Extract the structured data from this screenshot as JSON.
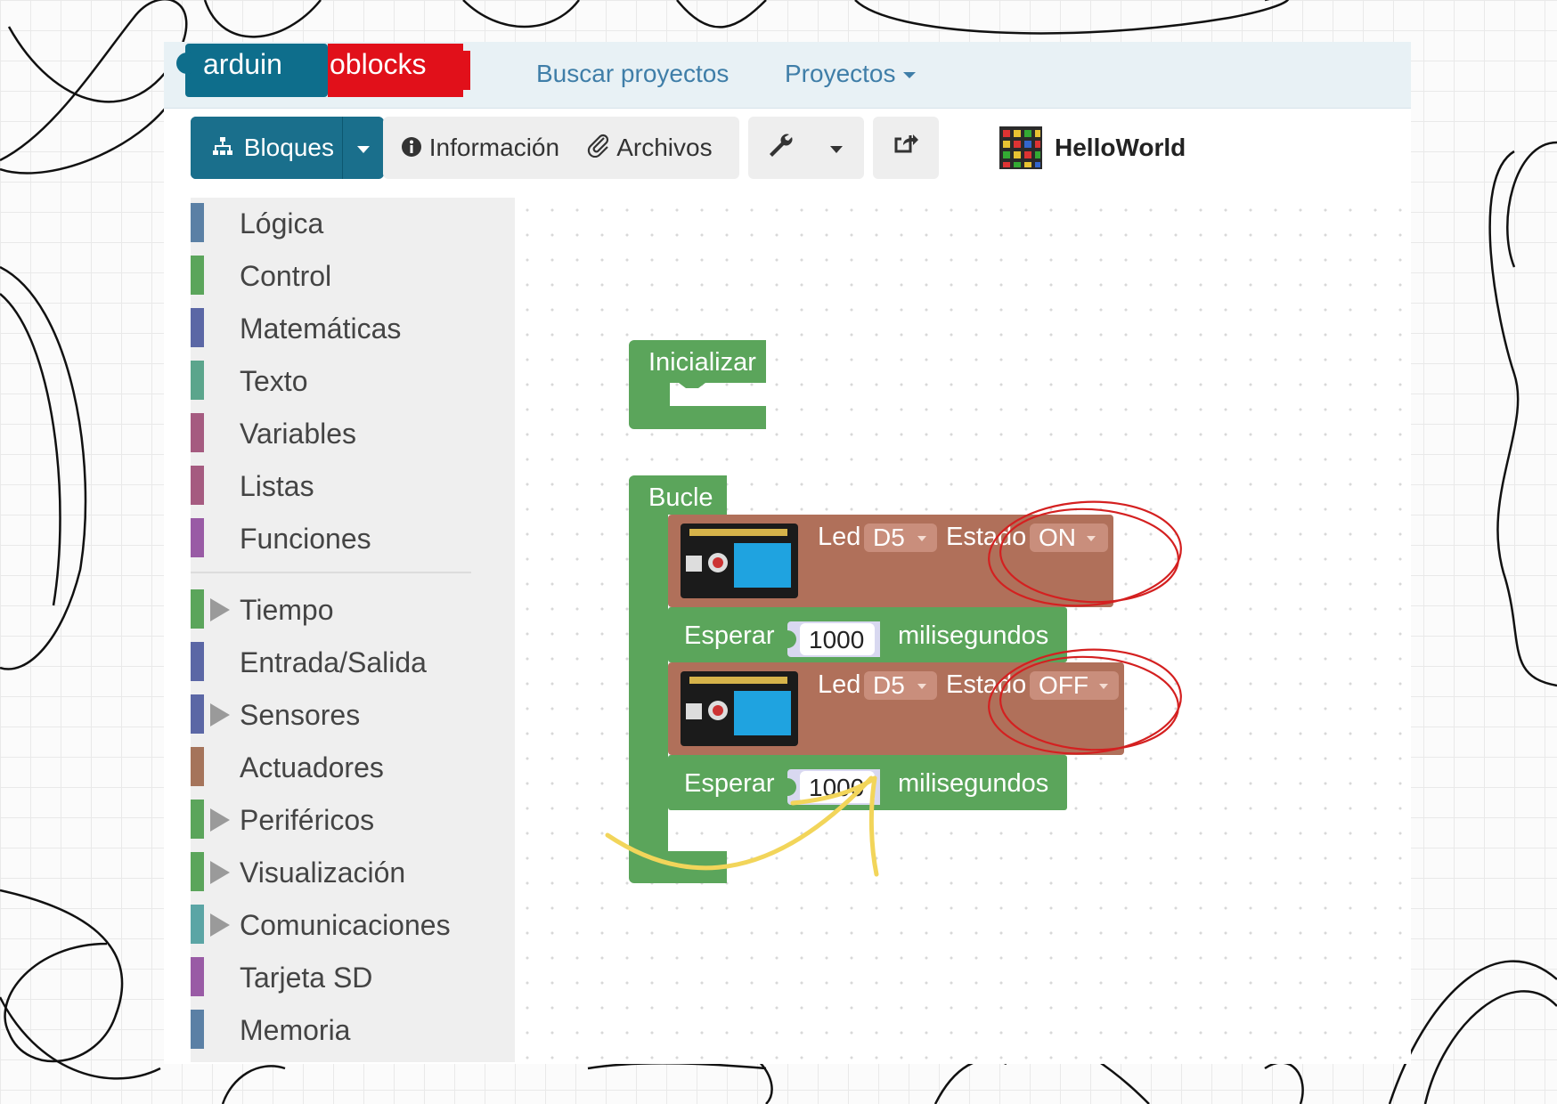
{
  "brand": {
    "logo_text_a": "arduin",
    "logo_text_b": "oblocks",
    "colors": {
      "teal": "#0e6e8c",
      "red": "#e1101a"
    }
  },
  "navbar": {
    "search_link": "Buscar proyectos",
    "projects_link": "Proyectos"
  },
  "toolbar": {
    "blocks_label": "Bloques",
    "info_label": "Información",
    "files_label": "Archivos",
    "project_name": "HelloWorld",
    "icons": {
      "blocks": "sitemap-icon",
      "info": "info-circle-icon",
      "files": "paperclip-icon",
      "tools": "wrench-icon",
      "share": "share-icon"
    }
  },
  "categories": [
    {
      "label": "Lógica",
      "color": "#5b80a5",
      "expandable": false
    },
    {
      "label": "Control",
      "color": "#5ba55b",
      "expandable": false
    },
    {
      "label": "Matemáticas",
      "color": "#5b67a5",
      "expandable": false
    },
    {
      "label": "Texto",
      "color": "#5ba58c",
      "expandable": false
    },
    {
      "label": "Variables",
      "color": "#a55b80",
      "expandable": false
    },
    {
      "label": "Listas",
      "color": "#a55b80",
      "expandable": false
    },
    {
      "label": "Funciones",
      "color": "#995ba5",
      "expandable": false
    },
    {
      "label": "Tiempo",
      "color": "#5ba55b",
      "expandable": true
    },
    {
      "label": "Entrada/Salida",
      "color": "#5b67a5",
      "expandable": false
    },
    {
      "label": "Sensores",
      "color": "#5b67a5",
      "expandable": true
    },
    {
      "label": "Actuadores",
      "color": "#a5745b",
      "expandable": false
    },
    {
      "label": "Periféricos",
      "color": "#5ba55b",
      "expandable": true
    },
    {
      "label": "Visualización",
      "color": "#5ba55b",
      "expandable": true
    },
    {
      "label": "Comunicaciones",
      "color": "#5ba5a5",
      "expandable": true
    },
    {
      "label": "Tarjeta SD",
      "color": "#995ba5",
      "expandable": false
    },
    {
      "label": "Memoria",
      "color": "#5b80a5",
      "expandable": false
    }
  ],
  "blocks": {
    "init_label": "Inicializar",
    "loop_label": "Bucle",
    "led1": {
      "led_label": "Led",
      "pin": "D5",
      "state_label": "Estado",
      "state": "ON"
    },
    "wait1": {
      "label": "Esperar",
      "value": "1000",
      "unit": "milisegundos"
    },
    "led2": {
      "led_label": "Led",
      "pin": "D5",
      "state_label": "Estado",
      "state": "OFF"
    },
    "wait2": {
      "label": "Esperar",
      "value": "1000",
      "unit": "milisegundos"
    },
    "colors": {
      "green": "#5ba55b",
      "actuator": "#b0705a",
      "dropdown": "#c98e7c",
      "number_field": "#d8d8f0"
    }
  },
  "annotations": {
    "circle_color": "#d42020",
    "arrow_color": "#f2d55a",
    "scribble_color": "#111111"
  }
}
